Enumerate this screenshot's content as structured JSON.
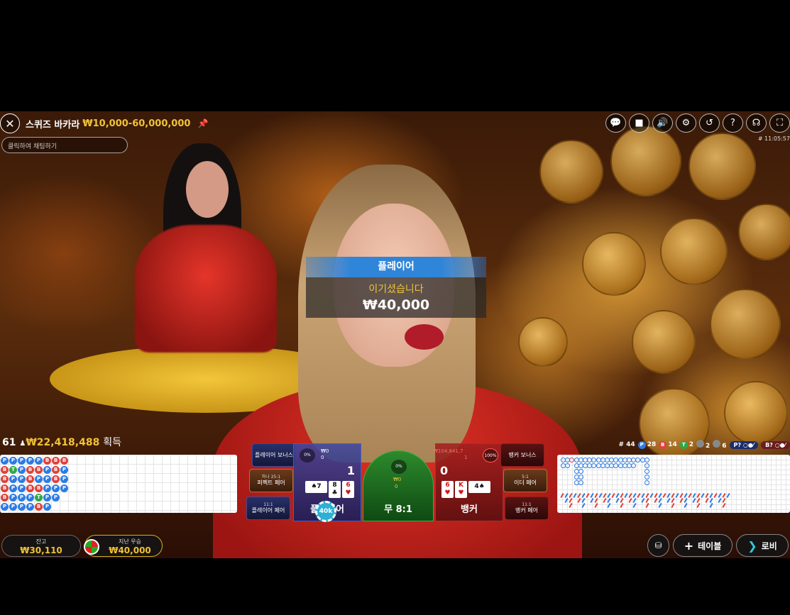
{
  "header": {
    "title": "스퀴즈 바카라",
    "limits": "₩10,000-60,000,000",
    "chat_placeholder": "클릭하여 채팅하기",
    "time": "# 11:05:57"
  },
  "top_icons": [
    "chat-icon",
    "video-icon",
    "volume-icon",
    "settings-icon",
    "history-icon",
    "help-icon",
    "headset-icon",
    "fullscreen-icon"
  ],
  "result": {
    "winner": "플레이어",
    "message": "이기셨습니다",
    "amount": "₩40,000"
  },
  "winners": {
    "count": "61",
    "amount": "₩22,418,488",
    "suffix": "획득"
  },
  "stats": {
    "rounds": "# 44",
    "player_letter": "P",
    "player": "28",
    "banker_letter": "B",
    "banker": "14",
    "tie_letter": "T",
    "tie": "2",
    "player_pair": "2",
    "banker_pair": "6",
    "p_predict": "P?",
    "b_predict": "B?"
  },
  "bead_road": [
    [
      "P",
      "B",
      "B",
      "B",
      "B",
      "P"
    ],
    [
      "P",
      "T",
      "P",
      "P",
      "P",
      "P"
    ],
    [
      "P",
      "P",
      "P",
      "P",
      "P",
      "P"
    ],
    [
      "P",
      "B",
      "B",
      "B",
      "P",
      "P"
    ],
    [
      "P",
      "B",
      "P",
      "B",
      "T",
      "B"
    ],
    [
      "B",
      "P",
      "P",
      "P",
      "P",
      "P"
    ],
    [
      "B",
      "B",
      "B",
      "P",
      "P",
      ""
    ],
    [
      "B",
      "P",
      "P",
      "P",
      "",
      ""
    ]
  ],
  "bet_panel": {
    "player_bonus": "플레이어 보너스",
    "perfect_pair_ratio": "하나 25:1",
    "perfect_pair": "퍼펙트 페어",
    "player_pair_ratio": "11:1",
    "player_pair": "플레이어 페어",
    "banker_bonus": "뱅커 보너스",
    "either_pair_ratio": "5:1",
    "either_pair": "이더 페어",
    "banker_pair_ratio": "11:1",
    "banker_pair": "뱅커 페어",
    "player_label": "플레이어",
    "player_score": "1",
    "player_pct": "0%",
    "player_amt": "₩0",
    "player_count": "0",
    "tie_label": "무 8:1",
    "tie_pct": "0%",
    "tie_amt": "₩0",
    "tie_count": "0",
    "banker_label": "뱅커",
    "banker_score": "0",
    "banker_pct": "100%",
    "banker_amt": "₩104,841,7",
    "banker_count": "1",
    "chip": "40k",
    "player_cards": [
      {
        "rank": "8",
        "suit": "♣",
        "red": false
      },
      {
        "rank": "6",
        "suit": "♥",
        "red": true
      }
    ],
    "player_side_card": {
      "rank": "7",
      "suit": "♠",
      "red": false
    },
    "banker_cards": [
      {
        "rank": "6",
        "suit": "♥",
        "red": true
      },
      {
        "rank": "K",
        "suit": "♥",
        "red": true
      }
    ],
    "banker_side_card": {
      "rank": "4",
      "suit": "♠",
      "red": false
    }
  },
  "footer": {
    "balance_label": "잔고",
    "balance": "₩30,110",
    "last_win_label": "지난 우승",
    "last_win": "₩40,000",
    "tables": "테이블",
    "lobby": "로비"
  },
  "colors": {
    "gold": "#f0c237",
    "player_blue": "#2c7be5",
    "banker_red": "#e0403a",
    "tie_green": "#2ea84a"
  }
}
